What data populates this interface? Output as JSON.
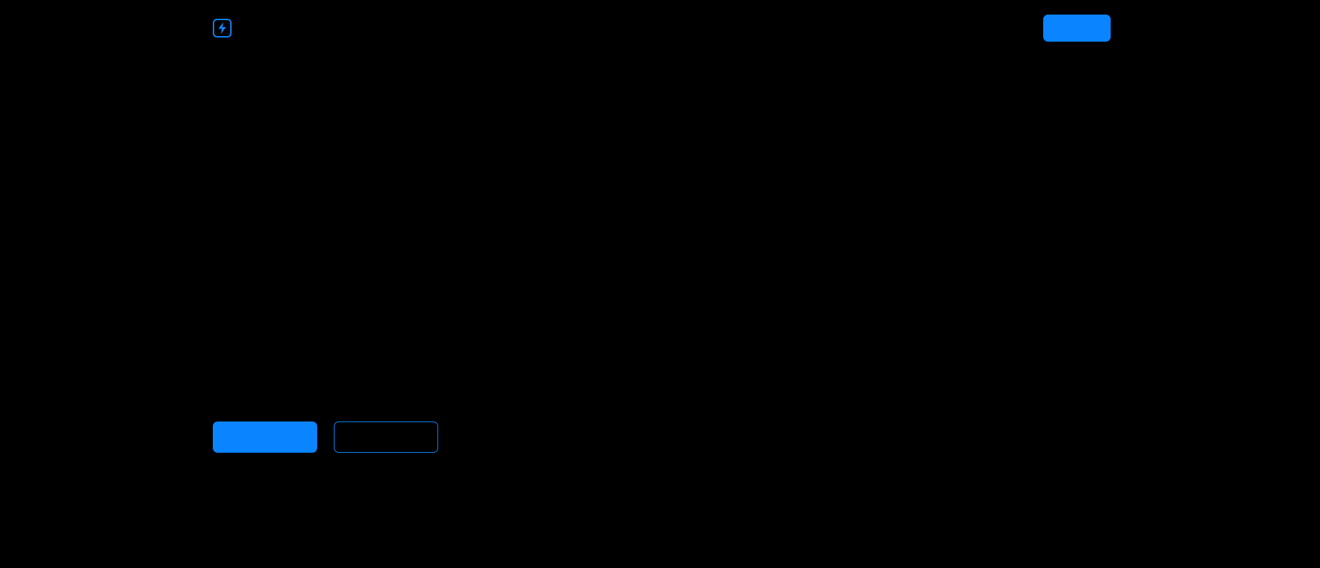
{
  "colors": {
    "background": "#000000",
    "accent": "#0a84ff"
  },
  "header": {
    "logo_icon": "lightning-bolt-icon",
    "cta_label": ""
  },
  "hero": {
    "primary_label": "",
    "secondary_label": ""
  }
}
